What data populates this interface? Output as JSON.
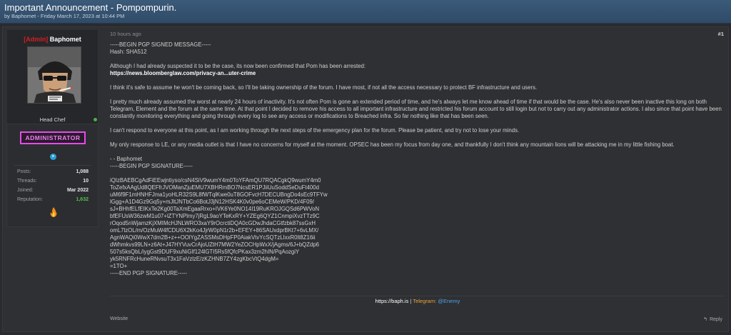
{
  "thread": {
    "title": "Important Announcement - Pompompurin.",
    "meta": "by Baphomet - Friday March 17, 2023 at 10:44 PM"
  },
  "user": {
    "tag": "[Admin]",
    "name": "Baphomet",
    "title": "Head Chef",
    "role_badge": "ADMINISTRATOR",
    "stats": {
      "posts_label": "Posts:",
      "posts": "1,088",
      "threads_label": "Threads:",
      "threads": "10",
      "joined_label": "Joined:",
      "joined": "Mar 2022",
      "reputation_label": "Reputation:",
      "reputation": "1,632"
    }
  },
  "post": {
    "date": "10 hours ago",
    "number": "#1",
    "pgp_begin": "-----BEGIN PGP SIGNED MESSAGE-----",
    "hash": "Hash: SHA512",
    "para1": "Although I had already suspected it to be the case, its now been confirmed that Pom has been arrested:",
    "link": "https://news.bloomberglaw.com/privacy-an...uter-crime",
    "para2": "I think it's safe to assume he won't be coming back, so I'll be taking ownership of the forum. I have most, if not all the access necessary to protect BF infrastructure and users.",
    "para3": "I pretty much already assumed the worst at nearly 24 hours of inactivity. It's not often Pom is gone an extended period of time, and he's always let me know ahead of time if that would be the case. He's also never been inactive this long on both Telegram, Element and the forum at the same time. At that point I decided to remove his access to all important infrastructure and restricted his forum account to still login but not to carry out any administrator actions. I also since that point have been constantly monitoring everything and going through every log to see any access or modifications to Breached infra. So far nothing like that has been seen.",
    "para4": "I can't respond to everyone at this point, as I am working through the next steps of the emergency plan for the forum. Please be patient, and try not to lose your minds.",
    "para5": "My only response to LE, or any media outlet is that I have no concerns for myself at the moment. OPSEC has been my focus from day one, and thankfully I don't think any mountain lions will be attacking me in my little fishing boat.",
    "signoff": "- - Baphomet",
    "sig_begin": "-----BEGIN PGP SIGNATURE-----",
    "sig_body": "iQIzBAEBCgAdFiEEwjntiyso/csN4SiV9wumY4m0ToYFAmQU7RQACgkQ9wumY4m0\nToZefxAAgUd8QEFfrJVOManZjuEMU7XBHRmBO7NcsER1PJiiUuSoddSeDuFt400d\nuM6f9F1mHNHFJma1yoHLR32S9L8fWTqlKwe0uT8GOFvcH7DECUBngDo4sEc9TFYw\nlGgg+A1D4Gz9Gq5y+mJltJNTbCo6BotJ3jN12HSK4K0v0pe6oCEMeW/PKD/4F09/\nsJ+BHhfELfEIKxTe2Kg00TaXmEgaaRrxo+IVK6Ye0NO14I19RuKROJGQSd6PWVoN\nbfEFUsW36zwM1u07+lZTYNPlmy7jRgL9aoYTeKxRY+YZEg6QYZ1CnmpiXvzTTz9C\nrOqod5nWjamzKjXMIMcHJNLWRO3xaY9rOcrctiDQA0cGDwJhdaCGtfzbk87ssGxH\nomL7lzOL/m/OzMuW4fCDU6X2kKo4JjrW0pN1r2b+EFEY+86SAUxdprBKt7+6vLMX/\nAgnWAQi0WwX7dm2B+z++OOlYgZASSMsDHpFP0AiakVtvYcSQTzLIxxR0lt8Z16ii\ndWhmkvs99LN+z6At+J47HYVuvCrAjoUZtH7MW2YeZOCHpWxX/jAgms/6J+bQZdp6\n507s5ksQbL/iygGst9DUF9xuNiGIf124lGTI5Rs5fQfcPKax3zm2hIN/PqAozgiY\nyk5RNFRcHuneRNvsuT3x1FaVzlzE/zKZHNB7ZY4zgKbcVtQ4dgM=\n=1TO+",
    "pgp_end": "-----END PGP SIGNATURE-----"
  },
  "signature": {
    "url": "https://baph.is",
    "separator": " | ",
    "label": "Telegram:",
    "handle": "@Enemy"
  },
  "footer": {
    "website": "Website",
    "reply": "Reply"
  },
  "icons": {
    "online": "online-status-dot",
    "telegram": "telegram-icon",
    "flame": "flame-icon",
    "reply": "reply-icon"
  },
  "colors": {
    "admin_tag": "#d31f1f",
    "role_badge": "#e34de7",
    "reputation": "#4fc24f",
    "telegram_label": "#e8a23c",
    "telegram_handle": "#4da3e6"
  }
}
